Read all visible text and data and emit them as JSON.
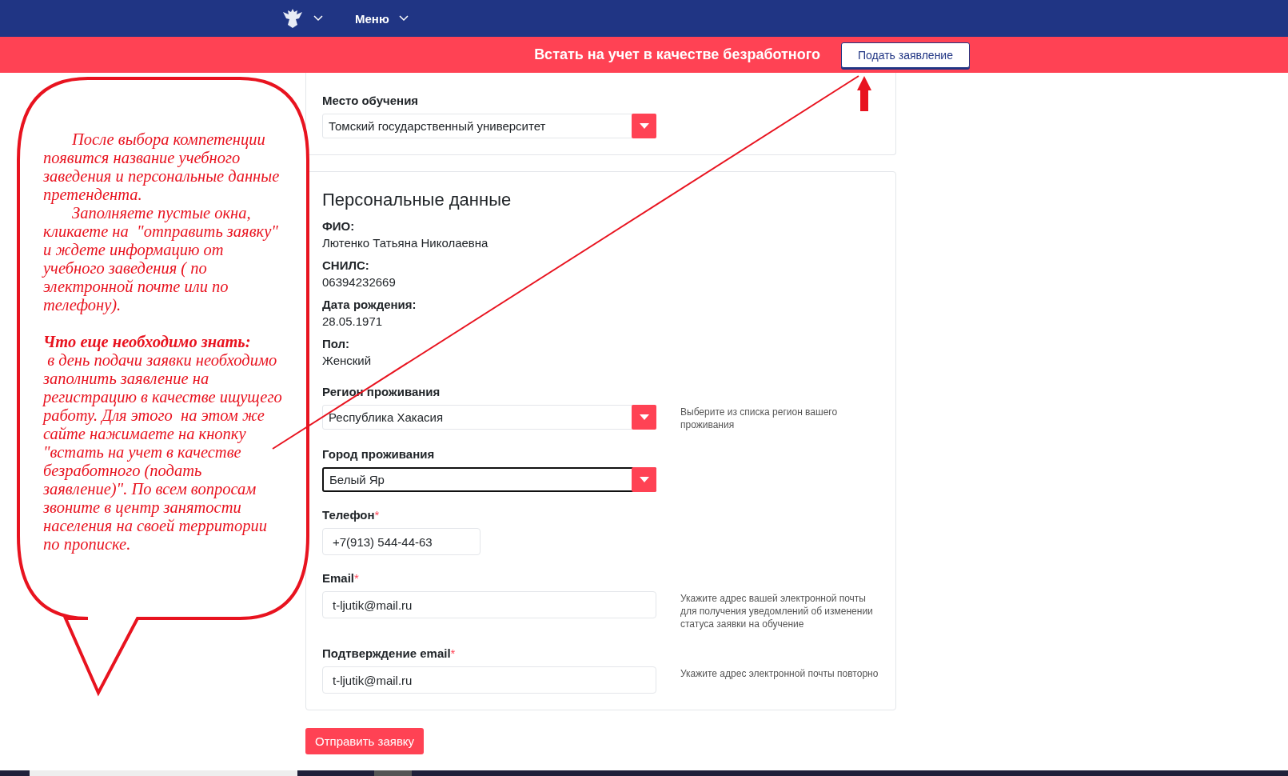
{
  "nav": {
    "menu_label": "Меню"
  },
  "banner": {
    "title": "Встать на учет в качестве безработного",
    "button": "Подать заявление"
  },
  "study": {
    "label": "Место обучения",
    "value": "Томский государственный университет"
  },
  "personal": {
    "heading": "Персональные данные",
    "info": [
      {
        "label": "ФИО:",
        "value": "Лютенко Татьяна Николаевна"
      },
      {
        "label": "СНИЛС:",
        "value": "06394232669"
      },
      {
        "label": "Дата рождения:",
        "value": "28.05.1971"
      },
      {
        "label": "Пол:",
        "value": "Женский"
      }
    ],
    "fields": [
      {
        "kind": "select",
        "label": "Регион проживания",
        "value": "Республика Хакасия",
        "focused": false,
        "hint": "Выберите из списка регион вашего проживания"
      },
      {
        "kind": "select",
        "label": "Город проживания",
        "value": "Белый Яр",
        "focused": true
      },
      {
        "kind": "short-input",
        "label": "Телефон",
        "required_mark": "*",
        "value": "+7(913) 544-44-63",
        "focused": false
      },
      {
        "kind": "input",
        "label": "Email",
        "required_mark": "*",
        "value": "t-ljutik@mail.ru",
        "focused": false,
        "hint": "Укажите адрес вашей электронной почты для получения уведомлений об изменении статуса заявки на обучение"
      },
      {
        "kind": "input",
        "label": "Подтверждение email",
        "required_mark": "*",
        "value": "t-ljutik@mail.ru",
        "focused": false,
        "hint": "Укажите адрес электронной почты повторно"
      }
    ]
  },
  "submit": "Отправить заявку",
  "annotation": {
    "paragraphs": [
      {
        "kind": "indented",
        "text": "После выбора компетенции появится название учебного заведения и персональные данные претендента."
      },
      {
        "kind": "indented",
        "text": "Заполняете пустые окна, кликаете на  \"отправить заявку\" и ждете информацию от учебного заведения ( по электронной почте или по телефону)."
      },
      {
        "kind": "heading",
        "text": "Что еще необходимо знать:"
      },
      {
        "kind": "plain",
        "text": " в день подачи заявки необходимо заполнить заявление на регистрацию в качестве ищущего работу. Для этого  на этом же сайте нажимаете на кнопку \"встать на учет в качестве безработного (подать заявление)\". По всем вопросам звоните в центр занятости населения на своей территории по прописке."
      }
    ]
  }
}
